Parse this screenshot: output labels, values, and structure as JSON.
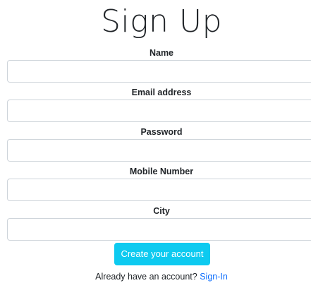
{
  "form": {
    "title": "Sign Up",
    "fields": [
      {
        "label": "Name",
        "value": "",
        "placeholder": ""
      },
      {
        "label": "Email address",
        "value": "",
        "placeholder": ""
      },
      {
        "label": "Password",
        "value": "",
        "placeholder": ""
      },
      {
        "label": "Mobile Number",
        "value": "",
        "placeholder": ""
      },
      {
        "label": "City",
        "value": "",
        "placeholder": ""
      }
    ],
    "submit_label": "Create your account",
    "footer_text": "Already have an account? ",
    "signin_link": "Sign-In"
  },
  "colors": {
    "button_bg": "#0dcaf0",
    "link": "#0d6efd",
    "input_border": "#ced4da"
  }
}
